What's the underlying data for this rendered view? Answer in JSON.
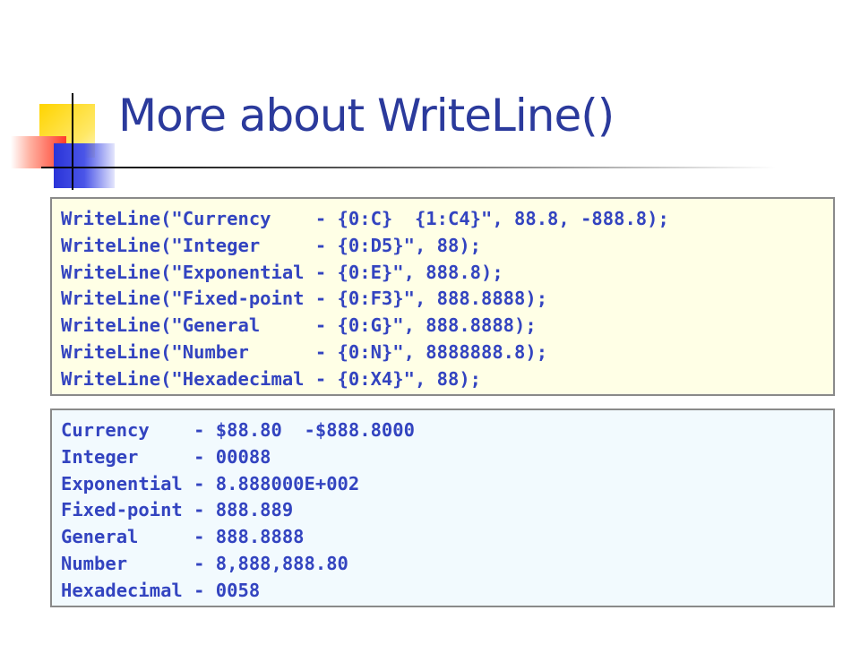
{
  "slide": {
    "title": "More about WriteLine()"
  },
  "code_example": {
    "lines": [
      "WriteLine(\"Currency    - {0:C}  {1:C4}\", 88.8, -888.8);",
      "WriteLine(\"Integer     - {0:D5}\", 88);",
      "WriteLine(\"Exponential - {0:E}\", 888.8);",
      "WriteLine(\"Fixed-point - {0:F3}\", 888.8888);",
      "WriteLine(\"General     - {0:G}\", 888.8888);",
      "WriteLine(\"Number      - {0:N}\", 8888888.8);",
      "WriteLine(\"Hexadecimal - {0:X4}\", 88);"
    ]
  },
  "output_example": {
    "lines": [
      "Currency    - $88.80  -$888.8000",
      "Integer     - 00088",
      "Exponential - 8.888000E+002",
      "Fixed-point - 888.889",
      "General     - 888.8888",
      "Number      - 8,888,888.80",
      "Hexadecimal - 0058"
    ]
  },
  "colors": {
    "title": "#2b3a9c",
    "code_text": "#3344c0",
    "code_background": "#ffffe6",
    "output_background": "#f2fafe",
    "box_border": "#8a8a8a",
    "accent_yellow": "#ffd400",
    "accent_red": "#ff3b2a",
    "accent_blue": "#2a34d8"
  }
}
